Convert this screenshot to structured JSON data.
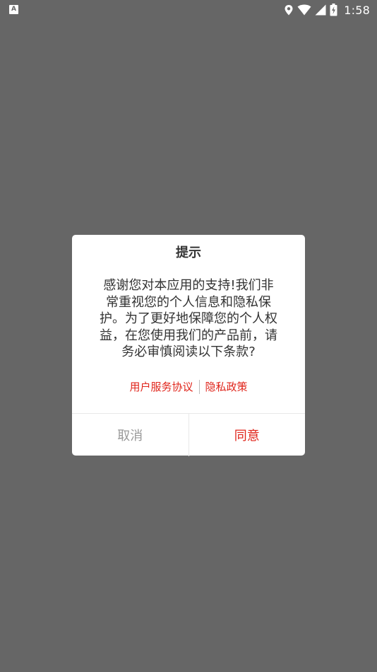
{
  "status_bar": {
    "notification_icon": "A",
    "time": "1:58",
    "icons": [
      "location-icon",
      "wifi-icon",
      "signal-icon",
      "battery-charging-icon"
    ]
  },
  "dialog": {
    "title": "提示",
    "message": "感谢您对本应用的支持!我们非常重视您的个人信息和隐私保护。为了更好地保障您的个人权益，在您使用我们的产品前，请务必审慎阅读以下条款?",
    "links": {
      "user_agreement": "用户服务协议",
      "privacy_policy": "隐私政策"
    },
    "buttons": {
      "cancel": "取消",
      "agree": "同意"
    }
  },
  "colors": {
    "overlay": "#666666",
    "accent": "#e0251b",
    "text": "#333333",
    "muted": "#999999"
  }
}
